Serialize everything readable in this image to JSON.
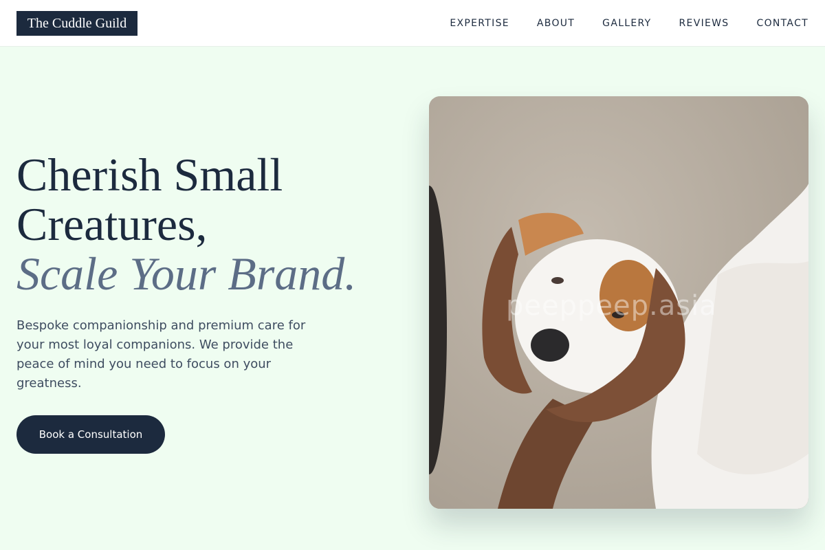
{
  "brand": {
    "name": "The Cuddle Guild"
  },
  "nav": {
    "items": [
      {
        "label": "EXPERTISE"
      },
      {
        "label": "ABOUT"
      },
      {
        "label": "GALLERY"
      },
      {
        "label": "REVIEWS"
      },
      {
        "label": "CONTACT"
      }
    ]
  },
  "hero": {
    "title_line1": "Cherish Small",
    "title_line2": "Creatures,",
    "title_accent": "Scale Your Brand.",
    "description": "Bespoke companionship and premium care for your most loyal companions. We provide the peace of mind you need to focus on your greatness.",
    "cta_label": "Book a Consultation",
    "image": {
      "subject": "puppy held in hands",
      "watermark": "peeppeep.asia"
    }
  },
  "colors": {
    "background": "#effdf1",
    "primary": "#1c2a3e",
    "accent_text": "#5c6d86",
    "body_text": "#3e4c60"
  }
}
